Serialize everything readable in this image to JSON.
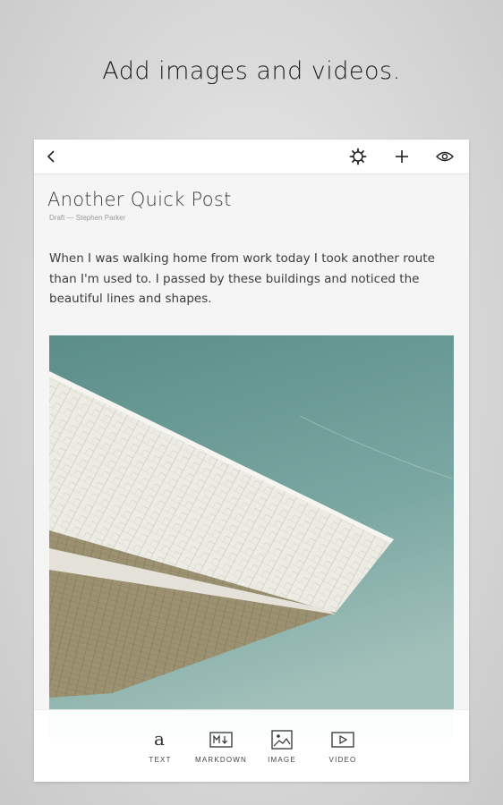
{
  "promo": {
    "headline": "Add images and videos."
  },
  "toolbar": {
    "back_icon": "chevron-left-icon",
    "settings_icon": "gear-icon",
    "add_icon": "plus-icon",
    "preview_icon": "eye-icon"
  },
  "post": {
    "title": "Another Quick Post",
    "meta": "Draft — Stephen Parker",
    "body": "When I was walking home from work today I took another route than I'm used to. I passed by these buildings and noticed the beautiful lines and shapes.",
    "image": {
      "subject": "architecture-photo"
    }
  },
  "insert_bar": {
    "items": [
      {
        "label": "TEXT",
        "icon": "text-icon"
      },
      {
        "label": "MARKDOWN",
        "icon": "markdown-icon"
      },
      {
        "label": "IMAGE",
        "icon": "image-icon"
      },
      {
        "label": "VIDEO",
        "icon": "video-icon"
      }
    ]
  },
  "colors": {
    "sky": "#6f9f9a",
    "facade_light": "#eceae3",
    "facade_shadow": "#9b8e6c"
  }
}
